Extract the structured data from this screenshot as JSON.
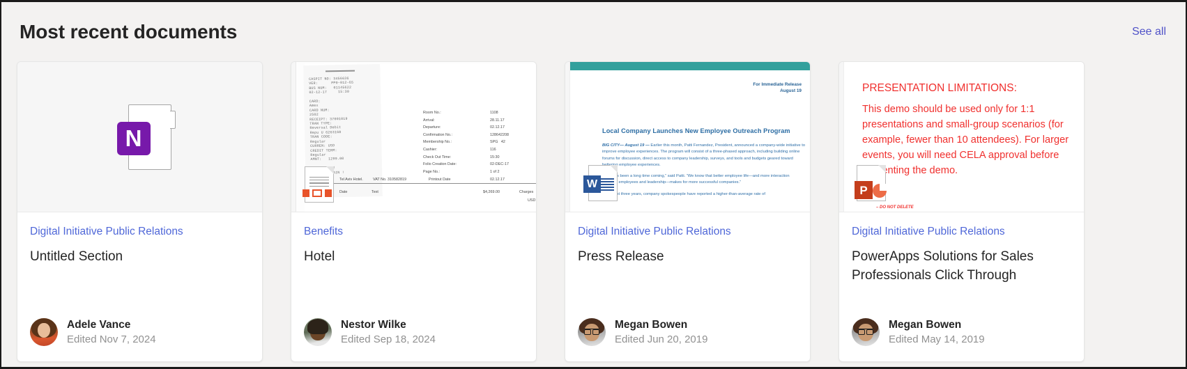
{
  "header": {
    "title": "Most recent documents",
    "see_all_label": "See all",
    "link_color": "#4f52c8"
  },
  "cards": [
    {
      "site": "Digital Initiative Public Relations",
      "title": "Untitled Section",
      "author": "Adele Vance",
      "edited": "Edited Nov 7, 2024",
      "thumbnail": {
        "kind": "onenote-icon",
        "icon": "onenote-icon",
        "badge_letter": "N",
        "accent": "#7719aa"
      }
    },
    {
      "site": "Benefits",
      "title": "Hotel",
      "author": "Nestor Wilke",
      "edited": "Edited Sep 18, 2024",
      "thumbnail": {
        "kind": "scanned-receipt",
        "icon": "pdf-file-icon",
        "receipt_text": "CASPIT NO: 3456636\nVER:      PP0-012-65\nBUS NUM:   01145622\n02-12-17     15:30\n\nCARD:\nAmex\nCARD NUM:\n2502\nRECEIPT: 37001019\nTRAN TYPE:\nReversal Debit\nRepu U 6263168\nTRAN CODE:\nRegular\nCURREN: USD\nCREDIT TERM:\nRegular\nAMNT:   1299.00\n\nTHANK YOU !\n   COME AGAIN !",
        "fields": [
          {
            "label": "Room No.:",
            "value": "1108"
          },
          {
            "label": "Arrival:",
            "value": "28.11.17"
          },
          {
            "label": "Departure:",
            "value": "02.12.17"
          },
          {
            "label": "Confirmation No.:",
            "value": "128642208"
          },
          {
            "label": "Membership No.:",
            "value": "SPG   42"
          },
          {
            "label": "Cashier:",
            "value": "116"
          },
          {
            "label": "Check Out Time:",
            "value": "15:30"
          },
          {
            "label": "Folio Creation Date:",
            "value": "02-DEC-17"
          },
          {
            "label": "Page No.:",
            "value": "1 of 2"
          }
        ],
        "footer_left": "Tel Aviv Hotel.",
        "footer_vat": "VAT No. 310582819",
        "footer_printout_label": "Printout Date",
        "footer_printout_value": "02.12.17",
        "table_headers": [
          "Date",
          "Text",
          "$4,269.00",
          "Charges"
        ],
        "table_currency": "USD"
      }
    },
    {
      "site": "Digital Initiative Public Relations",
      "title": "Press Release",
      "author": "Megan Bowen",
      "edited": "Edited Jun 20, 2019",
      "thumbnail": {
        "kind": "word-document",
        "icon": "word-file-icon",
        "band_color": "#32a09c",
        "release_line1": "For Immediate Release",
        "release_line2": "August 19",
        "heading": "Local Company Launches New Employee Outreach Program",
        "lead": "BIG CITY— August 19 —",
        "paragraph1": "Earlier this month, Patti Fernandez, President, announced a company-wide initiative to improve employee experiences. The program will consist of a three-phased approach, including building online forums for discussion, direct access to company leadership, surveys, and tools and budgets geared toward bettering employee experiences.",
        "paragraph2": "“This has been a long time coming,” said Patti. “We know that better employee life—and more interaction between employees and leadership—makes for more successful companies.”",
        "paragraph3": "In the last three years, company spokespeople have reported a higher-than-average rate of"
      }
    },
    {
      "site": "Digital Initiative Public Relations",
      "title": "PowerApps Solutions for Sales Professionals Click Through",
      "author": "Megan Bowen",
      "edited": "Edited May 14, 2019",
      "thumbnail": {
        "kind": "powerpoint-slide",
        "icon": "powerpoint-file-icon",
        "slide_title": "PRESENTATION LIMITATIONS:",
        "slide_body": "This demo should be used only for 1:1 presentations and small-group scenarios (for example, fewer than 10 attendees). For larger events, you will need CELA approval before presenting the demo.",
        "slide_note": "– DO NOT DELETE",
        "accent": "#f0302e"
      }
    }
  ]
}
